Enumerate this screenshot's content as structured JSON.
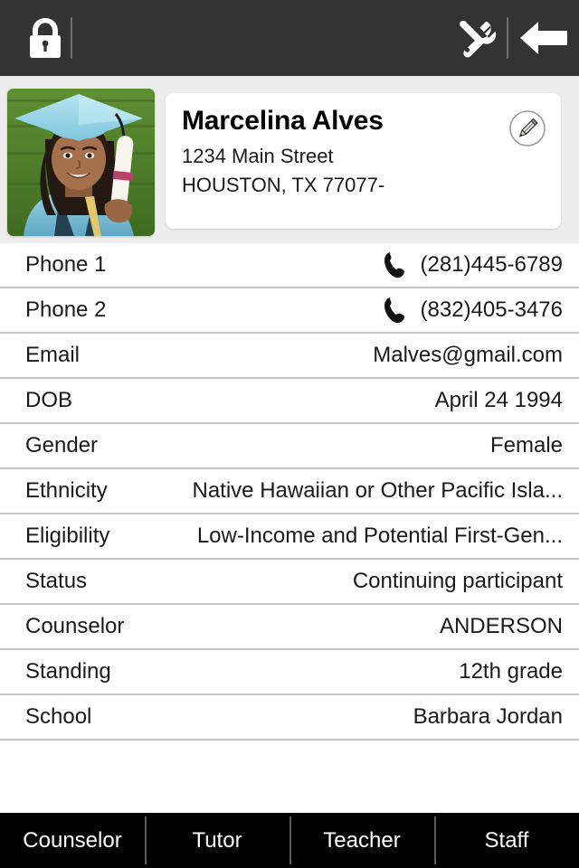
{
  "topbar": {
    "lock_icon": "lock-icon",
    "tools_icon": "tools-icon",
    "back_icon": "back-arrow-icon"
  },
  "profile": {
    "photo_alt": "graduation-photo",
    "name": "Marcelina Alves",
    "address_line1": "1234 Main Street",
    "address_line2": "HOUSTON, TX 77077-",
    "edit_icon": "edit-pencil-icon"
  },
  "details": [
    {
      "label": "Phone 1",
      "value": "(281)445-6789",
      "icon": "phone-icon"
    },
    {
      "label": "Phone 2",
      "value": "(832)405-3476",
      "icon": "phone-icon"
    },
    {
      "label": "Email",
      "value": "Malves@gmail.com",
      "icon": ""
    },
    {
      "label": "DOB",
      "value": "April 24 1994",
      "icon": ""
    },
    {
      "label": "Gender",
      "value": "Female",
      "icon": ""
    },
    {
      "label": "Ethnicity",
      "value": "Native Hawaiian or Other Pacific Isla...",
      "icon": ""
    },
    {
      "label": "Eligibility",
      "value": "Low-Income and Potential First-Gen...",
      "icon": ""
    },
    {
      "label": "Status",
      "value": "Continuing participant",
      "icon": ""
    },
    {
      "label": "Counselor",
      "value": "ANDERSON",
      "icon": ""
    },
    {
      "label": "Standing",
      "value": "12th grade",
      "icon": ""
    },
    {
      "label": "School",
      "value": "Barbara Jordan",
      "icon": ""
    }
  ],
  "tabs": [
    {
      "label": "Counselor"
    },
    {
      "label": "Tutor"
    },
    {
      "label": "Teacher"
    },
    {
      "label": "Staff"
    }
  ],
  "colors": {
    "topbar_bg": "#333333",
    "header_bg": "#ededed",
    "card_bg": "#ffffff",
    "separator": "#c6c6c6",
    "tabbar_bg": "#000000",
    "text": "#1a1a1a"
  }
}
